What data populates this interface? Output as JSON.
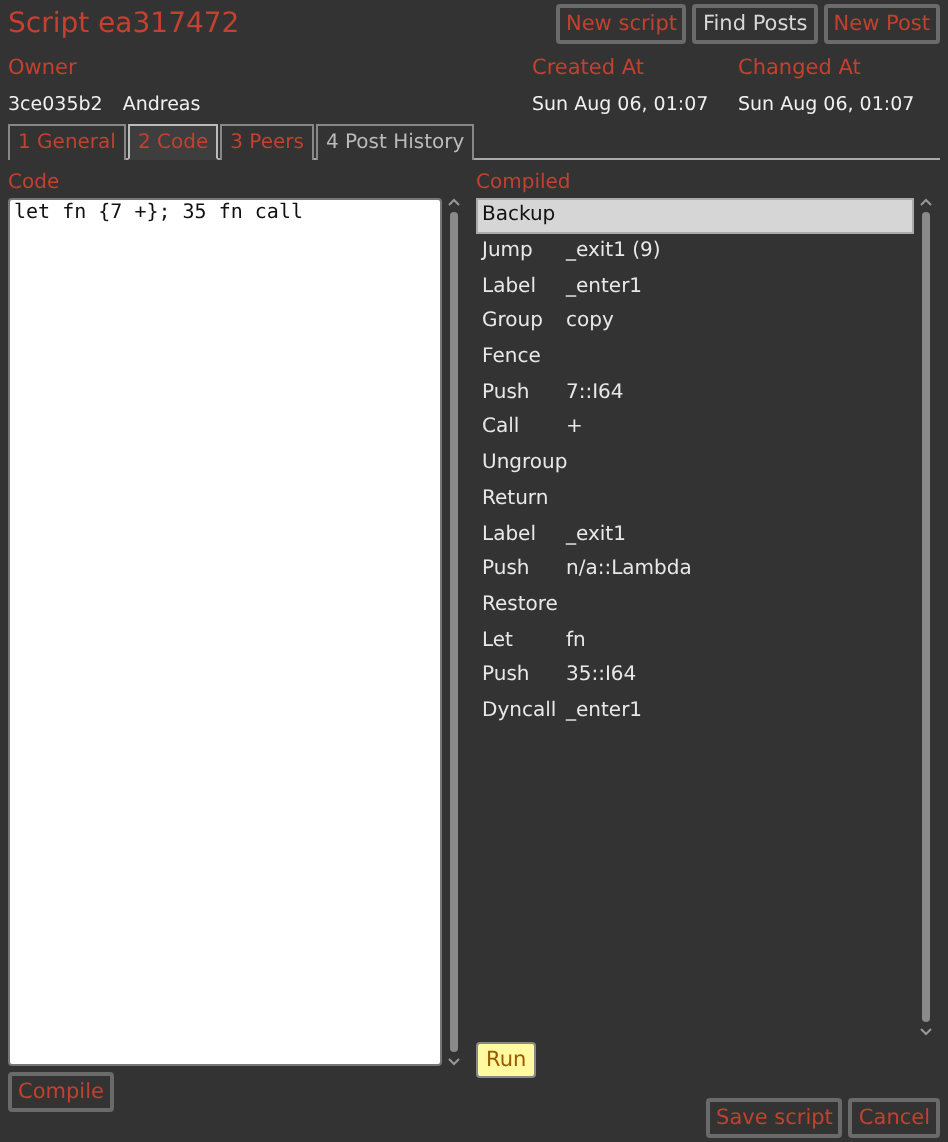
{
  "title": "Script ea317472",
  "header_buttons": [
    {
      "label": "New script",
      "disabled": true
    },
    {
      "label": "Find Posts",
      "disabled": false
    },
    {
      "label": "New Post",
      "disabled": true
    }
  ],
  "info": {
    "columns": [
      {
        "heading": "Owner",
        "values": [
          "3ce035b2",
          "Andreas"
        ]
      },
      {
        "heading": "Created At",
        "values": [
          "Sun Aug 06, 01:07"
        ]
      },
      {
        "heading": "Changed At",
        "values": [
          "Sun Aug 06, 01:07"
        ]
      }
    ]
  },
  "tabs": [
    {
      "label": "1 General",
      "selected": false,
      "disabled": true
    },
    {
      "label": "2 Code",
      "selected": true,
      "disabled": true
    },
    {
      "label": "3 Peers",
      "selected": false,
      "disabled": true
    },
    {
      "label": "4 Post History",
      "selected": false,
      "disabled": false
    }
  ],
  "code": {
    "label": "Code",
    "value": "let fn {7 +}; 35 fn call"
  },
  "compiled": {
    "label": "Compiled",
    "rows": [
      {
        "op": "Backup",
        "arg": "",
        "selected": true
      },
      {
        "op": "Jump",
        "arg": "_exit1 (9)",
        "selected": false
      },
      {
        "op": "Label",
        "arg": "_enter1",
        "selected": false
      },
      {
        "op": "Group",
        "arg": "copy",
        "selected": false
      },
      {
        "op": "Fence",
        "arg": "",
        "selected": false
      },
      {
        "op": "Push",
        "arg": "7::I64",
        "selected": false
      },
      {
        "op": "Call",
        "arg": "+",
        "selected": false
      },
      {
        "op": "Ungroup",
        "arg": "",
        "selected": false
      },
      {
        "op": "Return",
        "arg": "",
        "selected": false
      },
      {
        "op": "Label",
        "arg": "_exit1",
        "selected": false
      },
      {
        "op": "Push",
        "arg": "n/a::Lambda",
        "selected": false
      },
      {
        "op": "Restore",
        "arg": "",
        "selected": false
      },
      {
        "op": "Let",
        "arg": "fn",
        "selected": false
      },
      {
        "op": "Push",
        "arg": "35::I64",
        "selected": false
      },
      {
        "op": "Dyncall",
        "arg": "_enter1",
        "selected": false
      }
    ]
  },
  "compile_button": {
    "label": "Compile",
    "disabled": true
  },
  "run_button": {
    "label": "Run",
    "disabled": false
  },
  "footer_buttons": [
    {
      "label": "Save script",
      "disabled": true
    },
    {
      "label": "Cancel",
      "disabled": true
    }
  ]
}
